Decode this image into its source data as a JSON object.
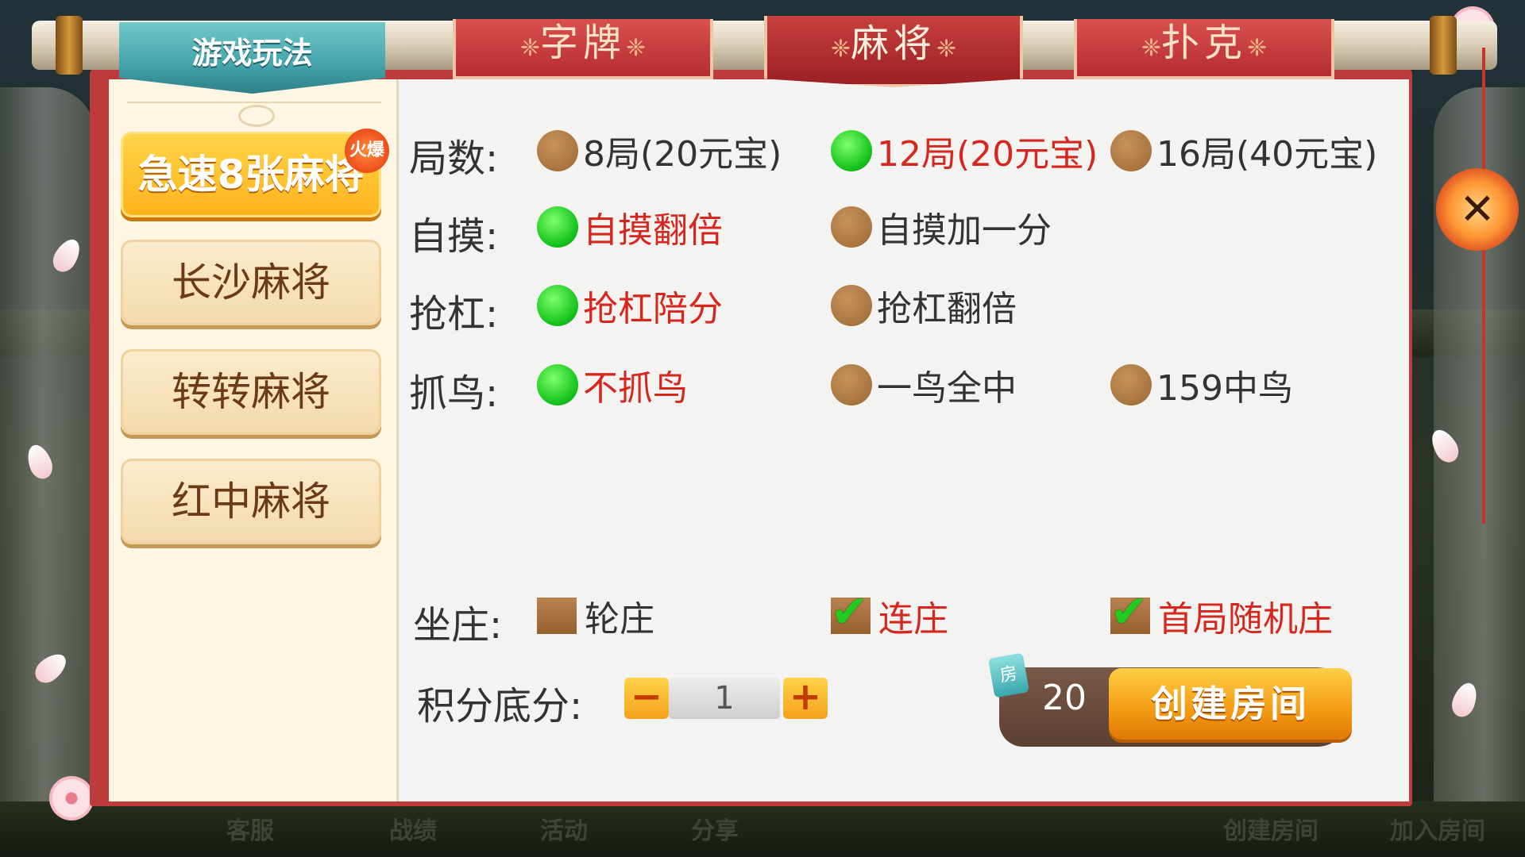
{
  "side": {
    "title": "游戏玩法",
    "items": [
      {
        "label": "急速8张麻将",
        "badge": "火爆",
        "active": true
      },
      {
        "label": "长沙麻将"
      },
      {
        "label": "转转麻将"
      },
      {
        "label": "红中麻将"
      }
    ]
  },
  "tabs": [
    {
      "label": "字牌",
      "active": false
    },
    {
      "label": "麻将",
      "active": true
    },
    {
      "label": "扑克",
      "active": false
    }
  ],
  "rules": {
    "rounds": {
      "label": "局数:",
      "options": [
        "8局(20元宝)",
        "12局(20元宝)",
        "16局(40元宝)"
      ],
      "selected": 1
    },
    "selfdraw": {
      "label": "自摸:",
      "options": [
        "自摸翻倍",
        "自摸加一分"
      ],
      "selected": 0
    },
    "kong": {
      "label": "抢杠:",
      "options": [
        "抢杠陪分",
        "抢杠翻倍"
      ],
      "selected": 0
    },
    "bird": {
      "label": "抓鸟:",
      "options": [
        "不抓鸟",
        "一鸟全中",
        "159中鸟"
      ],
      "selected": 0
    },
    "dealer": {
      "label": "坐庄:",
      "options": [
        "轮庄",
        "连庄",
        "首局随机庄"
      ],
      "checked": [
        false,
        true,
        true
      ]
    },
    "base_score": {
      "label": "积分底分:",
      "value": "1",
      "minus": "−",
      "plus": "+"
    }
  },
  "create": {
    "room_icon": "房",
    "cost": "20",
    "button": "创建房间"
  },
  "close": {
    "icon": "✕"
  },
  "bottom_bar": [
    "客服",
    "战绩",
    "活动",
    "分享",
    "创建房间",
    "加入房间"
  ],
  "colors": {
    "selected_text": "#d6271f",
    "panel_red": "#bd3b3b",
    "accent_orange": "#f39a12"
  }
}
